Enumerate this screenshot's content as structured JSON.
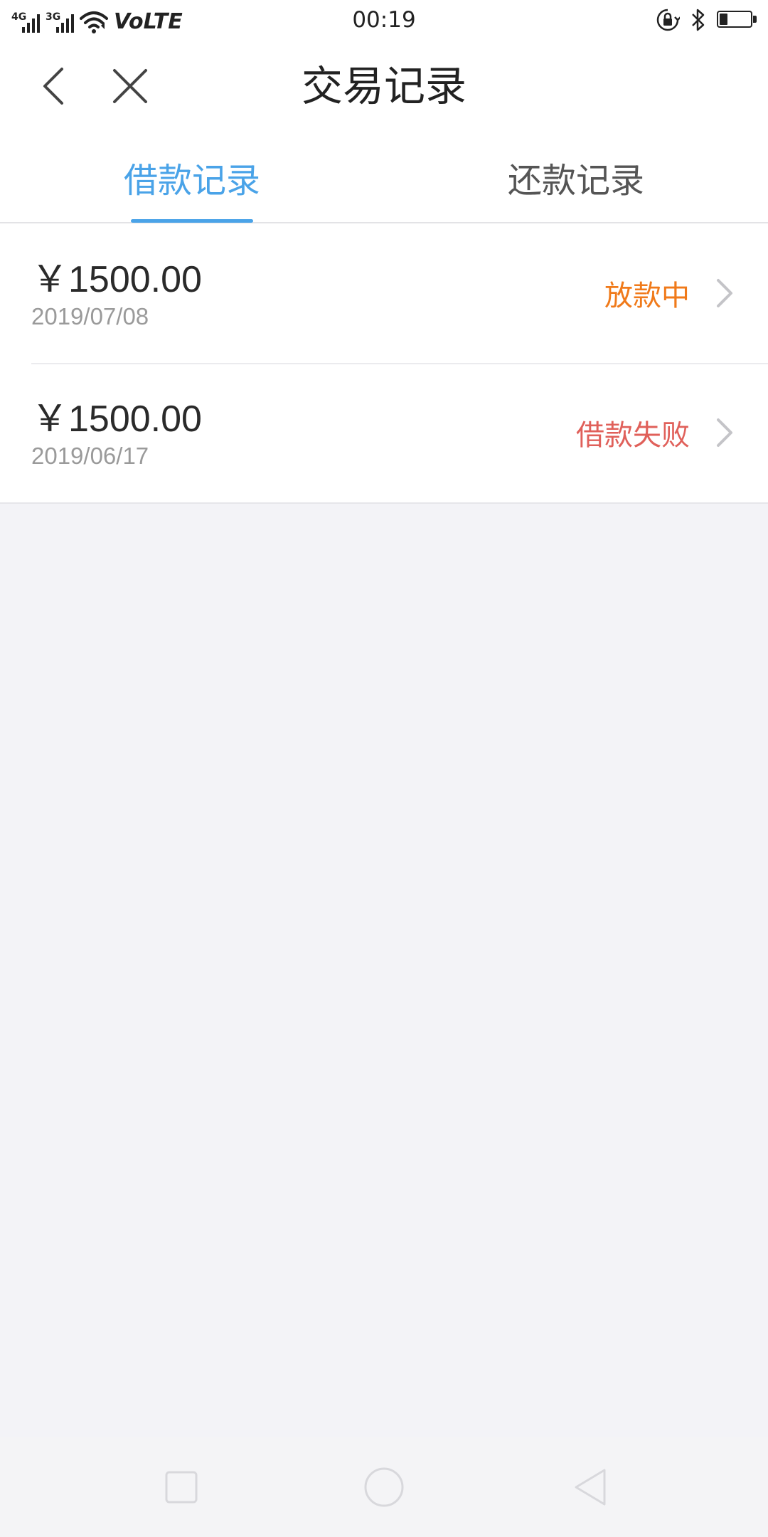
{
  "status_bar": {
    "time": "00:19",
    "network_1": "4G",
    "network_2": "3G",
    "volte": "VoLTE",
    "icons": [
      "signal-4g-icon",
      "signal-3g-icon",
      "wifi-icon",
      "rotation-lock-icon",
      "bluetooth-icon",
      "battery-icon"
    ],
    "battery_level": 0.25
  },
  "nav": {
    "title": "交易记录",
    "back_icon": "chevron-left-icon",
    "close_icon": "close-icon"
  },
  "tabs": [
    {
      "label": "借款记录",
      "active": true
    },
    {
      "label": "还款记录",
      "active": false
    }
  ],
  "records": [
    {
      "amount": "￥1500.00",
      "date": "2019/07/08",
      "status": "放款中",
      "status_color": "#f07a1a"
    },
    {
      "amount": "￥1500.00",
      "date": "2019/06/17",
      "status": "借款失败",
      "status_color": "#e0605a"
    }
  ],
  "colors": {
    "accent": "#4aa3e8",
    "background": "#f3f3f7",
    "surface": "#ffffff"
  },
  "system_nav": {
    "icons": [
      "recent-apps-icon",
      "home-icon",
      "back-triangle-icon"
    ]
  }
}
